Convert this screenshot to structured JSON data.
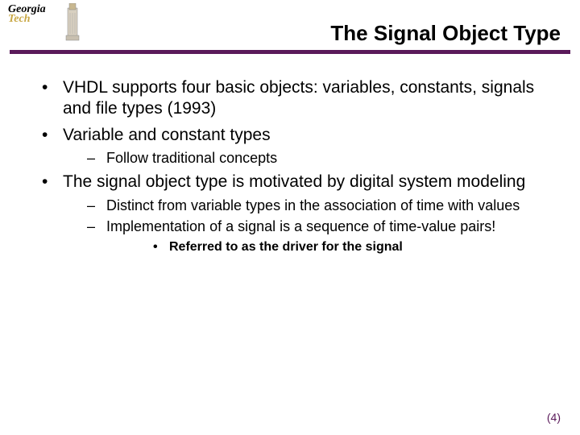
{
  "logo": {
    "line1": "Georgia",
    "line2": "Tech"
  },
  "title": "The Signal Object Type",
  "bullets": [
    {
      "text": "VHDL supports four basic objects: variables, constants, signals and file types (1993)",
      "sub": []
    },
    {
      "text": "Variable and constant types",
      "sub": [
        {
          "text": "Follow traditional concepts",
          "sub": []
        }
      ]
    },
    {
      "text": "The signal object type is motivated by digital system modeling",
      "sub": [
        {
          "text": "Distinct from variable types in the association of time with values",
          "sub": []
        },
        {
          "text": "Implementation of a signal is a sequence of time-value pairs!",
          "sub": [
            {
              "text": "Referred to as the driver for the signal"
            }
          ]
        }
      ]
    }
  ],
  "pagenum": "(4)"
}
